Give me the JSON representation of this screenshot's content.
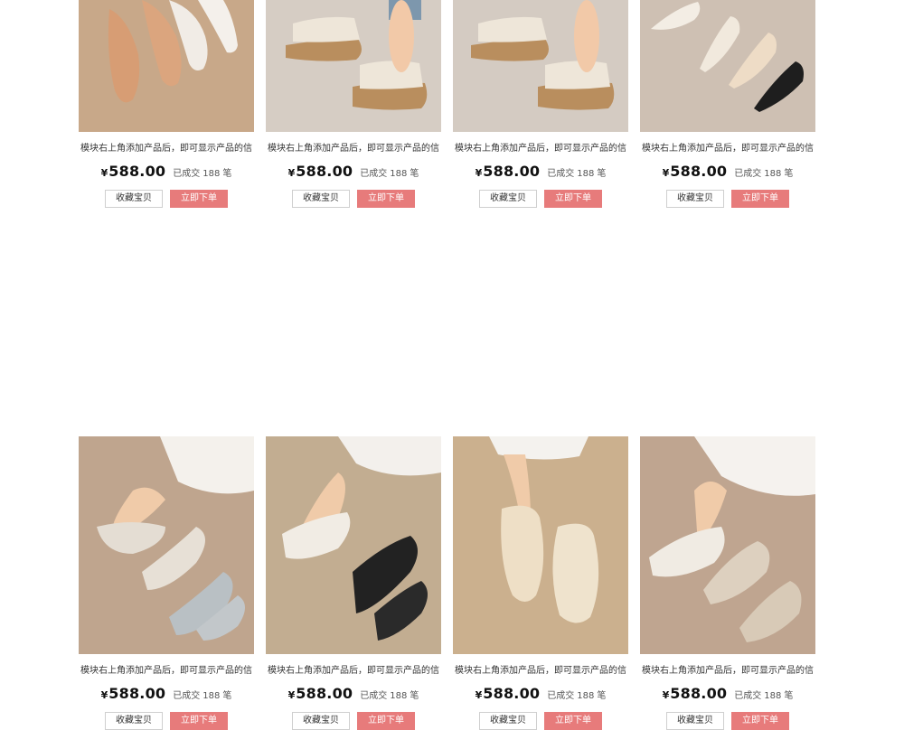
{
  "products": [
    {
      "title": "模块右上角添加产品后，即可显示产品的信",
      "currency": "¥",
      "price": "588.00",
      "sold_label": "已成交",
      "sold_count": "188",
      "sold_unit": "笔",
      "fav_label": "收藏宝贝",
      "buy_label": "立即下单",
      "bg": "#c8a889",
      "shoe": "#d9a27c"
    },
    {
      "title": "模块右上角添加产品后，即可显示产品的信",
      "currency": "¥",
      "price": "588.00",
      "sold_label": "已成交",
      "sold_count": "188",
      "sold_unit": "笔",
      "fav_label": "收藏宝贝",
      "buy_label": "立即下单",
      "bg": "#d6cdc4",
      "shoe": "#eee6d9"
    },
    {
      "title": "模块右上角添加产品后，即可显示产品的信",
      "currency": "¥",
      "price": "588.00",
      "sold_label": "已成交",
      "sold_count": "188",
      "sold_unit": "笔",
      "fav_label": "收藏宝贝",
      "buy_label": "立即下单",
      "bg": "#d4cbc2",
      "shoe": "#eee6d9"
    },
    {
      "title": "模块右上角添加产品后，即可显示产品的信",
      "currency": "¥",
      "price": "588.00",
      "sold_label": "已成交",
      "sold_count": "188",
      "sold_unit": "笔",
      "fav_label": "收藏宝贝",
      "buy_label": "立即下单",
      "bg": "#cec0b3",
      "shoe": "#efe7dc"
    },
    {
      "title": "模块右上角添加产品后，即可显示产品的信",
      "currency": "¥",
      "price": "588.00",
      "sold_label": "已成交",
      "sold_count": "188",
      "sold_unit": "笔",
      "fav_label": "收藏宝贝",
      "buy_label": "立即下单",
      "bg": "#bfa58e",
      "shoe": "#ddd6cc"
    },
    {
      "title": "模块右上角添加产品后，即可显示产品的信",
      "currency": "¥",
      "price": "588.00",
      "sold_label": "已成交",
      "sold_count": "188",
      "sold_unit": "笔",
      "fav_label": "收藏宝贝",
      "buy_label": "立即下单",
      "bg": "#c2ad91",
      "shoe": "#f1ece4"
    },
    {
      "title": "模块右上角添加产品后，即可显示产品的信",
      "currency": "¥",
      "price": "588.00",
      "sold_label": "已成交",
      "sold_count": "188",
      "sold_unit": "笔",
      "fav_label": "收藏宝贝",
      "buy_label": "立即下单",
      "bg": "#cbb08e",
      "shoe": "#efe3cd"
    },
    {
      "title": "模块右上角添加产品后，即可显示产品的信",
      "currency": "¥",
      "price": "588.00",
      "sold_label": "已成交",
      "sold_count": "188",
      "sold_unit": "笔",
      "fav_label": "收藏宝贝",
      "buy_label": "立即下单",
      "bg": "#bfa590",
      "shoe": "#e9dfd1"
    }
  ]
}
